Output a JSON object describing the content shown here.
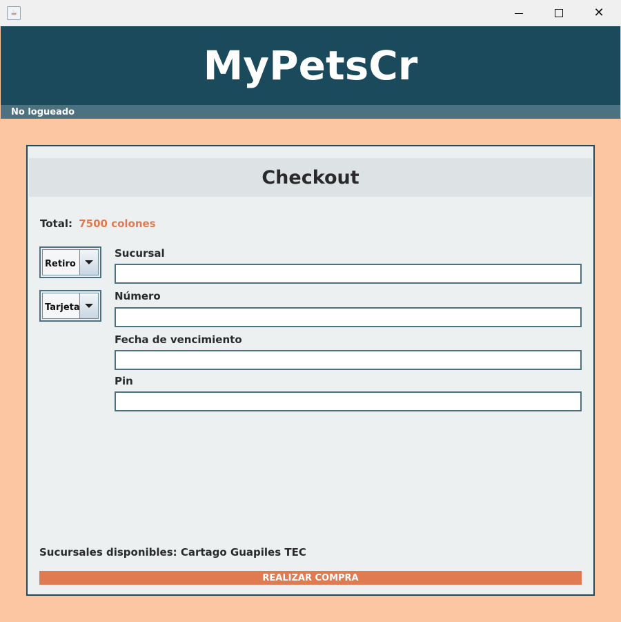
{
  "window": {
    "icon": "java-cup-icon",
    "controls": {
      "minimize": "minimize-icon",
      "maximize": "maximize-icon",
      "close": "close-icon"
    }
  },
  "header": {
    "title": "MyPetsCr"
  },
  "status": {
    "text": "No logueado"
  },
  "checkout": {
    "title": "Checkout",
    "total_label": "Total:",
    "total_value": "7500 colones",
    "delivery_select": "Retiro",
    "payment_select": "Tarjeta",
    "fields": [
      {
        "label": "Sucursal",
        "value": ""
      },
      {
        "label": "Número",
        "value": ""
      },
      {
        "label": "Fecha de vencimiento",
        "value": ""
      },
      {
        "label": "Pin",
        "value": ""
      }
    ],
    "branches_text": "Sucursales disponibles: Cartago Guapiles TEC",
    "buy_label": "REALIZAR COMPRA"
  },
  "colors": {
    "header": "#1b4a5c",
    "status_bar": "#4c7180",
    "background": "#fcc6a3",
    "accent": "#e07a50",
    "card": "#ecf0f1"
  }
}
